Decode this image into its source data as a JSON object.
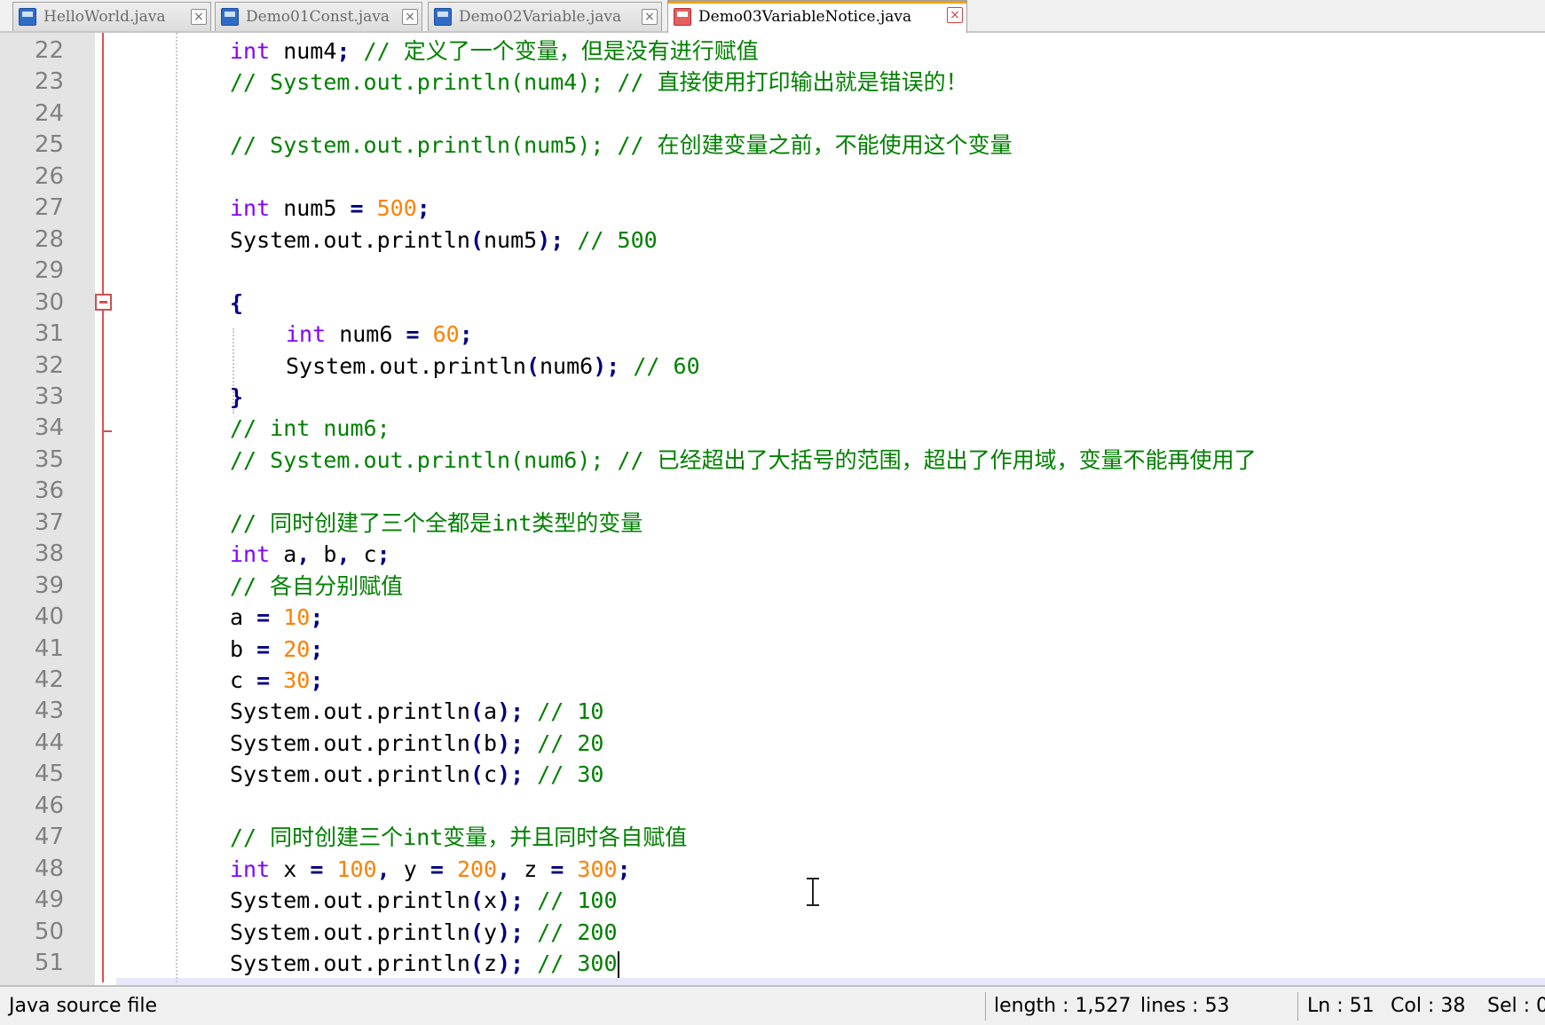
{
  "tabs": [
    {
      "label": "HelloWorld.java",
      "active": false,
      "icon": "java-file-icon"
    },
    {
      "label": "Demo01Const.java",
      "active": false,
      "icon": "java-file-icon"
    },
    {
      "label": "Demo02Variable.java",
      "active": false,
      "icon": "java-file-icon"
    },
    {
      "label": "Demo03VariableNotice.java",
      "active": true,
      "icon": "modified-file-icon"
    }
  ],
  "tab_close_glyph": "×",
  "editor": {
    "line_numbers": [
      "22",
      "23",
      "24",
      "25",
      "26",
      "27",
      "28",
      "29",
      "30",
      "31",
      "32",
      "33",
      "34",
      "35",
      "36",
      "37",
      "38",
      "39",
      "40",
      "41",
      "42",
      "43",
      "44",
      "45",
      "46",
      "47",
      "48",
      "49",
      "50",
      "51"
    ],
    "lines": [
      [
        [
          "kw",
          "int"
        ],
        [
          "t",
          " num4"
        ],
        [
          "op",
          ";"
        ],
        [
          "cmt",
          " // 定义了一个变量，但是没有进行赋值"
        ]
      ],
      [
        [
          "cmt",
          "// System.out.println(num4); // 直接使用打印输出就是错误的！"
        ]
      ],
      [],
      [
        [
          "cmt",
          "// System.out.println(num5); // 在创建变量之前，不能使用这个变量"
        ]
      ],
      [],
      [
        [
          "kw",
          "int"
        ],
        [
          "t",
          " num5 "
        ],
        [
          "op",
          "="
        ],
        [
          "t",
          " "
        ],
        [
          "num",
          "500"
        ],
        [
          "op",
          ";"
        ]
      ],
      [
        [
          "t",
          "System.out.println"
        ],
        [
          "op",
          "("
        ],
        [
          "t",
          "num5"
        ],
        [
          "op",
          ");"
        ],
        [
          "cmt",
          " // 500"
        ]
      ],
      [],
      [
        [
          "op",
          "{"
        ]
      ],
      [
        [
          "kw",
          "int"
        ],
        [
          "t",
          " num6 "
        ],
        [
          "op",
          "="
        ],
        [
          "t",
          " "
        ],
        [
          "num",
          "60"
        ],
        [
          "op",
          ";"
        ]
      ],
      [
        [
          "t",
          "System.out.println"
        ],
        [
          "op",
          "("
        ],
        [
          "t",
          "num6"
        ],
        [
          "op",
          ");"
        ],
        [
          "cmt",
          " // 60"
        ]
      ],
      [
        [
          "op",
          "}"
        ]
      ],
      [
        [
          "cmt",
          "// int num6;"
        ]
      ],
      [
        [
          "cmt",
          "// System.out.println(num6); // 已经超出了大括号的范围，超出了作用域，变量不能再使用了"
        ]
      ],
      [],
      [
        [
          "cmt",
          "// 同时创建了三个全都是int类型的变量"
        ]
      ],
      [
        [
          "kw",
          "int"
        ],
        [
          "t",
          " a"
        ],
        [
          "op",
          ","
        ],
        [
          "t",
          " b"
        ],
        [
          "op",
          ","
        ],
        [
          "t",
          " c"
        ],
        [
          "op",
          ";"
        ]
      ],
      [
        [
          "cmt",
          "// 各自分别赋值"
        ]
      ],
      [
        [
          "t",
          "a "
        ],
        [
          "op",
          "="
        ],
        [
          "t",
          " "
        ],
        [
          "num",
          "10"
        ],
        [
          "op",
          ";"
        ]
      ],
      [
        [
          "t",
          "b "
        ],
        [
          "op",
          "="
        ],
        [
          "t",
          " "
        ],
        [
          "num",
          "20"
        ],
        [
          "op",
          ";"
        ]
      ],
      [
        [
          "t",
          "c "
        ],
        [
          "op",
          "="
        ],
        [
          "t",
          " "
        ],
        [
          "num",
          "30"
        ],
        [
          "op",
          ";"
        ]
      ],
      [
        [
          "t",
          "System.out.println"
        ],
        [
          "op",
          "("
        ],
        [
          "t",
          "a"
        ],
        [
          "op",
          ");"
        ],
        [
          "cmt",
          " // 10"
        ]
      ],
      [
        [
          "t",
          "System.out.println"
        ],
        [
          "op",
          "("
        ],
        [
          "t",
          "b"
        ],
        [
          "op",
          ");"
        ],
        [
          "cmt",
          " // 20"
        ]
      ],
      [
        [
          "t",
          "System.out.println"
        ],
        [
          "op",
          "("
        ],
        [
          "t",
          "c"
        ],
        [
          "op",
          ");"
        ],
        [
          "cmt",
          " // 30"
        ]
      ],
      [],
      [
        [
          "cmt",
          "// 同时创建三个int变量，并且同时各自赋值"
        ]
      ],
      [
        [
          "kw",
          "int"
        ],
        [
          "t",
          " x "
        ],
        [
          "op",
          "="
        ],
        [
          "t",
          " "
        ],
        [
          "num",
          "100"
        ],
        [
          "op",
          ","
        ],
        [
          "t",
          " y "
        ],
        [
          "op",
          "="
        ],
        [
          "t",
          " "
        ],
        [
          "num",
          "200"
        ],
        [
          "op",
          ","
        ],
        [
          "t",
          " z "
        ],
        [
          "op",
          "="
        ],
        [
          "t",
          " "
        ],
        [
          "num",
          "300"
        ],
        [
          "op",
          ";"
        ]
      ],
      [
        [
          "t",
          "System.out.println"
        ],
        [
          "op",
          "("
        ],
        [
          "t",
          "x"
        ],
        [
          "op",
          ");"
        ],
        [
          "cmt",
          " // 100"
        ]
      ],
      [
        [
          "t",
          "System.out.println"
        ],
        [
          "op",
          "("
        ],
        [
          "t",
          "y"
        ],
        [
          "op",
          ");"
        ],
        [
          "cmt",
          " // 200"
        ]
      ],
      [
        [
          "t",
          "System.out.println"
        ],
        [
          "op",
          "("
        ],
        [
          "t",
          "z"
        ],
        [
          "op",
          ");"
        ],
        [
          "cmt",
          " // 300"
        ]
      ]
    ]
  },
  "status": {
    "file_type": "Java source file",
    "length": "length : 1,527",
    "lines": "lines : 53",
    "ln": "Ln : 51",
    "col": "Col : 38",
    "sel": "Sel : 0"
  },
  "colors": {
    "keyword": "#8000ff",
    "number": "#ff8000",
    "comment": "#008000",
    "operator": "#000080",
    "current_line": "#e8e8fa",
    "active_tab_accent": "#f4a000"
  }
}
